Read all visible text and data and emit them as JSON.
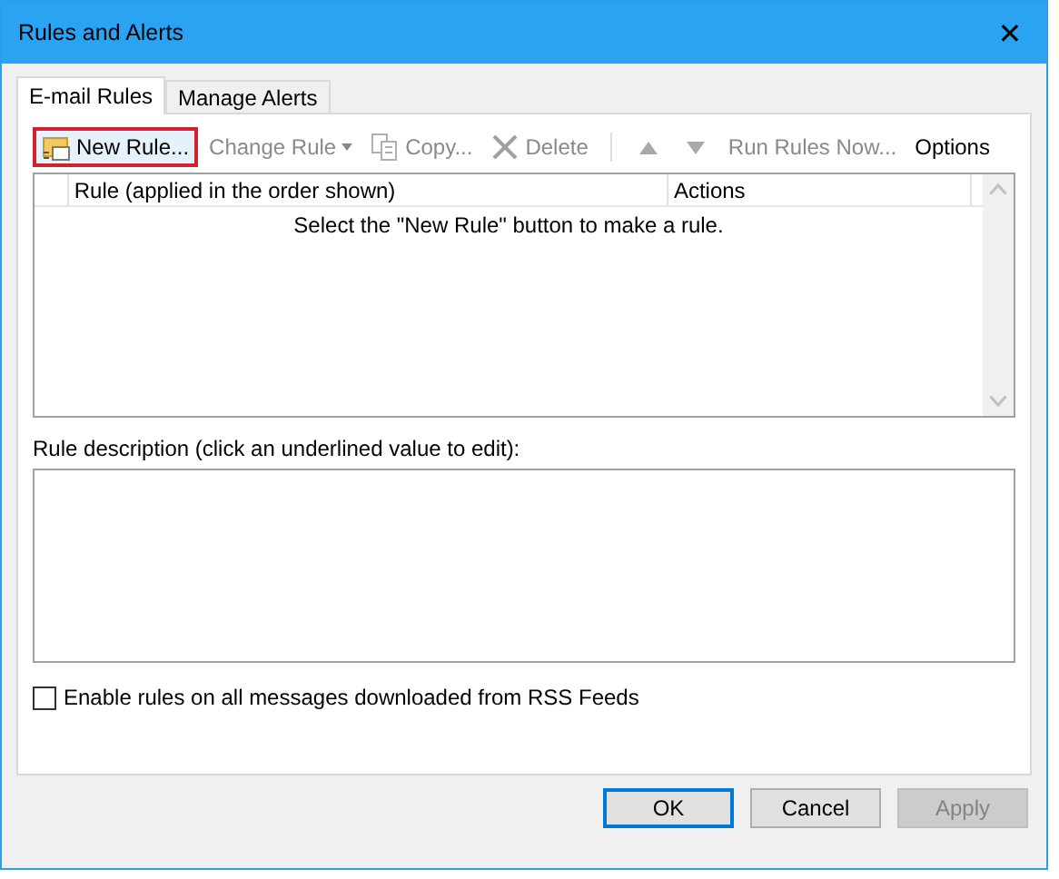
{
  "window": {
    "title": "Rules and Alerts",
    "close": "✕"
  },
  "tabs": [
    {
      "label": "E-mail Rules",
      "selected": true
    },
    {
      "label": "Manage Alerts",
      "selected": false
    }
  ],
  "toolbar": [
    {
      "kind": "new",
      "label": "New Rule...",
      "disabled": false,
      "highlighted": true
    },
    {
      "kind": "dropdown",
      "label": "Change Rule",
      "disabled": true,
      "highlighted": false
    },
    {
      "kind": "copy",
      "label": "Copy...",
      "disabled": true,
      "highlighted": false
    },
    {
      "kind": "delete",
      "label": "Delete",
      "disabled": true,
      "highlighted": false
    },
    {
      "kind": "separator"
    },
    {
      "kind": "up",
      "disabled": true
    },
    {
      "kind": "down",
      "disabled": true
    },
    {
      "kind": "text",
      "label": "Run Rules Now...",
      "disabled": true,
      "highlighted": false
    },
    {
      "kind": "text",
      "label": "Options",
      "disabled": false,
      "highlighted": false
    }
  ],
  "table": {
    "columns": [
      "Rule (applied in the order shown)",
      "Actions"
    ],
    "empty_message": "Select the \"New Rule\" button to make a rule."
  },
  "description": {
    "label": "Rule description (click an underlined value to edit):"
  },
  "rss_checkbox": {
    "label": "Enable rules on all messages downloaded from RSS Feeds",
    "checked": false
  },
  "buttons": [
    {
      "label": "OK",
      "default": true,
      "disabled": false
    },
    {
      "label": "Cancel",
      "default": false,
      "disabled": false
    },
    {
      "label": "Apply",
      "default": false,
      "disabled": true
    }
  ]
}
